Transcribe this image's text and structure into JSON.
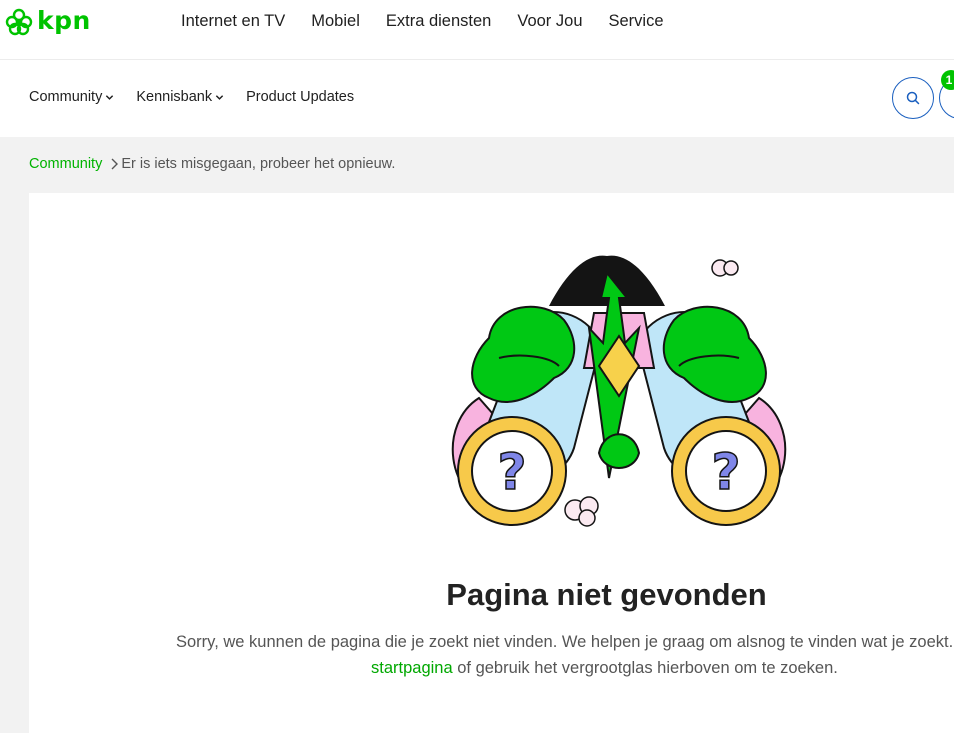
{
  "brand": {
    "name": "kpn",
    "color": "#00c300"
  },
  "topnav": {
    "items": [
      "Internet en TV",
      "Mobiel",
      "Extra diensten",
      "Voor Jou",
      "Service"
    ]
  },
  "subnav": {
    "community": "Community",
    "kennisbank": "Kennisbank",
    "product_updates": "Product Updates"
  },
  "header": {
    "search_icon": "search-icon",
    "notification_count": "1"
  },
  "breadcrumb": {
    "root": "Community",
    "current": "Er is iets misgegaan, probeer het opnieuw."
  },
  "error": {
    "title": "Pagina niet gevonden",
    "message": "Sorry, we kunnen de pagina die je zoekt niet vinden. We helpen je graag om alsnog te vinden wat je zoekt.",
    "link_text": "startpagina",
    "message_suffix": " of gebruik het vergrootglas hierboven om te zoeken.",
    "illustration": "binoculars-question-icon"
  },
  "colors": {
    "accent_green": "#00c300",
    "link_blue": "#1a5fbf",
    "background": "#f2f2f2"
  }
}
